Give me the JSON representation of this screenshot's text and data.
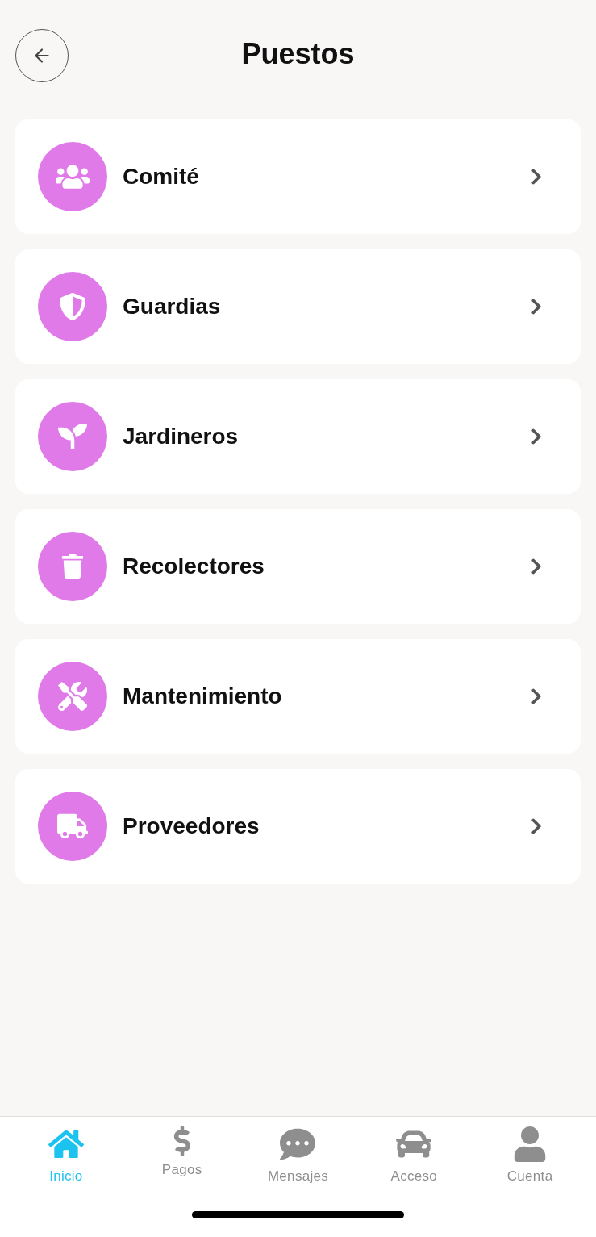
{
  "header": {
    "title": "Puestos"
  },
  "items": [
    {
      "label": "Comité"
    },
    {
      "label": "Guardias"
    },
    {
      "label": "Jardineros"
    },
    {
      "label": "Recolectores"
    },
    {
      "label": "Mantenimiento"
    },
    {
      "label": "Proveedores"
    }
  ],
  "tab_bar": [
    {
      "label": "Inicio",
      "selected": true
    },
    {
      "label": "Pagos",
      "selected": false
    },
    {
      "label": "Mensajes",
      "selected": false
    },
    {
      "label": "Acceso",
      "selected": false
    },
    {
      "label": "Cuenta",
      "selected": false
    }
  ]
}
